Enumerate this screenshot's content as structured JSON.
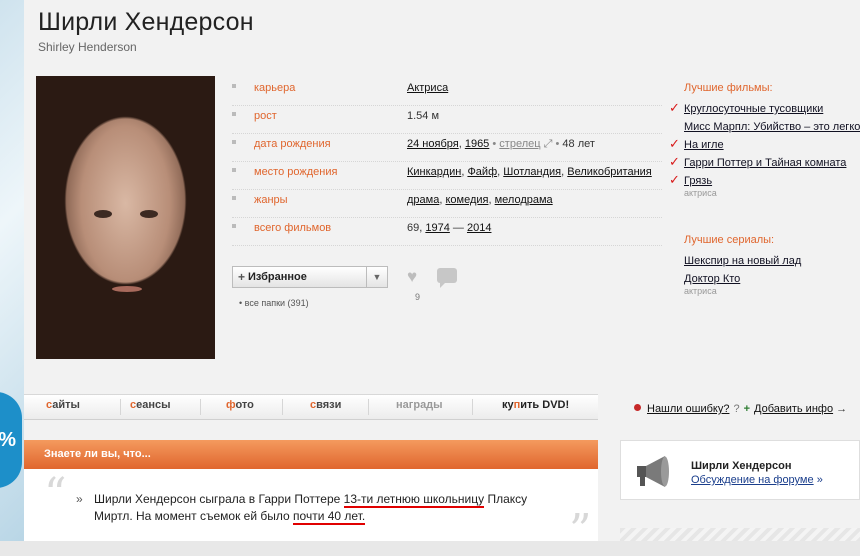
{
  "header": {
    "title": "Ширли Хендерсон",
    "subtitle": "Shirley Henderson"
  },
  "left_badge": "%",
  "info": {
    "career": {
      "label": "карьера",
      "value": "Актриса"
    },
    "height": {
      "label": "рост",
      "value": "1.54 м"
    },
    "birth_date": {
      "label": "дата рождения",
      "day": "24 ноября",
      "year": "1965",
      "sign": "стрелец",
      "age": "48 лет"
    },
    "birth_place": {
      "label": "место рождения",
      "places": [
        "Кинкардин",
        "Файф",
        "Шотландия",
        "Великобритания"
      ]
    },
    "genres": {
      "label": "жанры",
      "items": [
        "драма",
        "комедия",
        "мелодрама"
      ]
    },
    "total_films": {
      "label": "всего фильмов",
      "count": "69",
      "from": "1974",
      "to": "2014"
    }
  },
  "favorites": {
    "button_label": "Избранное",
    "folders": "все папки (391)",
    "likes": "9"
  },
  "best_films": {
    "heading": "Лучшие фильмы:",
    "items": [
      {
        "title": "Круглосуточные тусовщики"
      },
      {
        "title": "Мисс Марпл: Убийство – это легко!"
      },
      {
        "title": "На игле"
      },
      {
        "title": "Гарри Поттер и Тайная комната"
      },
      {
        "title": "Грязь"
      }
    ],
    "role_note": "актриса"
  },
  "best_series": {
    "heading": "Лучшие сериалы:",
    "items": [
      {
        "title": "Шекспир на новый лад"
      },
      {
        "title": "Доктор Кто"
      }
    ],
    "role_note": "актриса"
  },
  "tabs": [
    {
      "first": "с",
      "rest": "айты"
    },
    {
      "first": "с",
      "rest": "еансы"
    },
    {
      "first": "ф",
      "rest": "ото"
    },
    {
      "first": "с",
      "rest": "вязи"
    },
    {
      "label": "награды"
    },
    {
      "pre": "ку",
      "accent": "п",
      "post": "ить DVD!"
    }
  ],
  "actions": {
    "report_error": "Нашли ошибку?",
    "question_mark": "?",
    "add_info": "Добавить инфо",
    "arrow": "→"
  },
  "did_you_know": {
    "heading": "Знаете ли вы, что...",
    "fact_part1": "Ширли Хендерсон сыграла в Гарри Поттере ",
    "fact_highlight1": "13-ти летнюю школьницу",
    "fact_part2": " Плаксу Миртл. На момент съемок ей было ",
    "fact_highlight2": "почти 40 лет.",
    "bullet": "»",
    "quote_open": "“",
    "quote_close": "”"
  },
  "forum": {
    "name": "Ширли Хендерсон",
    "link": "Обсуждение на форуме",
    "arrow": "»"
  }
}
